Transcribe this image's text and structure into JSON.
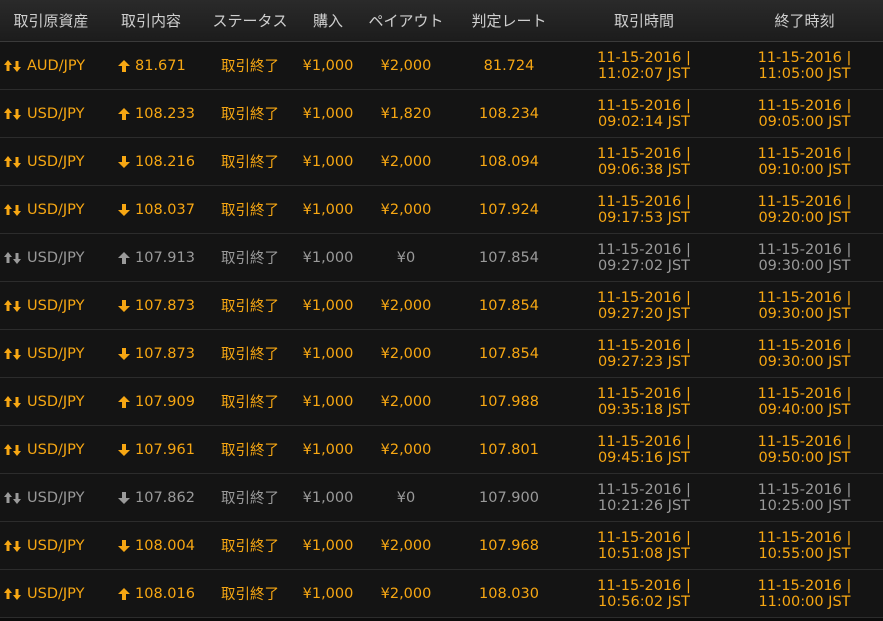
{
  "colors": {
    "win": "#f7a713",
    "lose": "#9a9a9a",
    "header_text": "#cfcfcf",
    "background": "#141414"
  },
  "header": {
    "asset": "取引原資産",
    "content": "取引内容",
    "status": "ステータス",
    "purchase": "購入",
    "payout": "ペイアウト",
    "judge_rate": "判定レート",
    "trade_time": "取引時間",
    "end_time": "終了時刻"
  },
  "rows": [
    {
      "result": "win",
      "asset_icon": "exchange-arrows-icon",
      "asset": "AUD/JPY",
      "direction": "up",
      "rate": "81.671",
      "status": "取引終了",
      "purchase": "¥1,000",
      "payout": "¥2,000",
      "judge_rate": "81.724",
      "trade_date": "11-15-2016 |",
      "trade_clock": "11:02:07 JST",
      "end_date": "11-15-2016 |",
      "end_clock": "11:05:00 JST"
    },
    {
      "result": "win",
      "asset_icon": "exchange-arrows-icon",
      "asset": "USD/JPY",
      "direction": "up",
      "rate": "108.233",
      "status": "取引終了",
      "purchase": "¥1,000",
      "payout": "¥1,820",
      "judge_rate": "108.234",
      "trade_date": "11-15-2016 |",
      "trade_clock": "09:02:14 JST",
      "end_date": "11-15-2016 |",
      "end_clock": "09:05:00 JST"
    },
    {
      "result": "win",
      "asset_icon": "exchange-arrows-icon",
      "asset": "USD/JPY",
      "direction": "down",
      "rate": "108.216",
      "status": "取引終了",
      "purchase": "¥1,000",
      "payout": "¥2,000",
      "judge_rate": "108.094",
      "trade_date": "11-15-2016 |",
      "trade_clock": "09:06:38 JST",
      "end_date": "11-15-2016 |",
      "end_clock": "09:10:00 JST"
    },
    {
      "result": "win",
      "asset_icon": "exchange-arrows-icon",
      "asset": "USD/JPY",
      "direction": "down",
      "rate": "108.037",
      "status": "取引終了",
      "purchase": "¥1,000",
      "payout": "¥2,000",
      "judge_rate": "107.924",
      "trade_date": "11-15-2016 |",
      "trade_clock": "09:17:53 JST",
      "end_date": "11-15-2016 |",
      "end_clock": "09:20:00 JST"
    },
    {
      "result": "lose",
      "asset_icon": "exchange-arrows-icon",
      "asset": "USD/JPY",
      "direction": "up",
      "rate": "107.913",
      "status": "取引終了",
      "purchase": "¥1,000",
      "payout": "¥0",
      "judge_rate": "107.854",
      "trade_date": "11-15-2016 |",
      "trade_clock": "09:27:02 JST",
      "end_date": "11-15-2016 |",
      "end_clock": "09:30:00 JST"
    },
    {
      "result": "win",
      "asset_icon": "exchange-arrows-icon",
      "asset": "USD/JPY",
      "direction": "down",
      "rate": "107.873",
      "status": "取引終了",
      "purchase": "¥1,000",
      "payout": "¥2,000",
      "judge_rate": "107.854",
      "trade_date": "11-15-2016 |",
      "trade_clock": "09:27:20 JST",
      "end_date": "11-15-2016 |",
      "end_clock": "09:30:00 JST"
    },
    {
      "result": "win",
      "asset_icon": "exchange-arrows-icon",
      "asset": "USD/JPY",
      "direction": "down",
      "rate": "107.873",
      "status": "取引終了",
      "purchase": "¥1,000",
      "payout": "¥2,000",
      "judge_rate": "107.854",
      "trade_date": "11-15-2016 |",
      "trade_clock": "09:27:23 JST",
      "end_date": "11-15-2016 |",
      "end_clock": "09:30:00 JST"
    },
    {
      "result": "win",
      "asset_icon": "exchange-arrows-icon",
      "asset": "USD/JPY",
      "direction": "up",
      "rate": "107.909",
      "status": "取引終了",
      "purchase": "¥1,000",
      "payout": "¥2,000",
      "judge_rate": "107.988",
      "trade_date": "11-15-2016 |",
      "trade_clock": "09:35:18 JST",
      "end_date": "11-15-2016 |",
      "end_clock": "09:40:00 JST"
    },
    {
      "result": "win",
      "asset_icon": "exchange-arrows-icon",
      "asset": "USD/JPY",
      "direction": "down",
      "rate": "107.961",
      "status": "取引終了",
      "purchase": "¥1,000",
      "payout": "¥2,000",
      "judge_rate": "107.801",
      "trade_date": "11-15-2016 |",
      "trade_clock": "09:45:16 JST",
      "end_date": "11-15-2016 |",
      "end_clock": "09:50:00 JST"
    },
    {
      "result": "lose",
      "asset_icon": "exchange-arrows-icon",
      "asset": "USD/JPY",
      "direction": "down",
      "rate": "107.862",
      "status": "取引終了",
      "purchase": "¥1,000",
      "payout": "¥0",
      "judge_rate": "107.900",
      "trade_date": "11-15-2016 |",
      "trade_clock": "10:21:26 JST",
      "end_date": "11-15-2016 |",
      "end_clock": "10:25:00 JST"
    },
    {
      "result": "win",
      "asset_icon": "exchange-arrows-icon",
      "asset": "USD/JPY",
      "direction": "down",
      "rate": "108.004",
      "status": "取引終了",
      "purchase": "¥1,000",
      "payout": "¥2,000",
      "judge_rate": "107.968",
      "trade_date": "11-15-2016 |",
      "trade_clock": "10:51:08 JST",
      "end_date": "11-15-2016 |",
      "end_clock": "10:55:00 JST"
    },
    {
      "result": "win",
      "asset_icon": "exchange-arrows-icon",
      "asset": "USD/JPY",
      "direction": "up",
      "rate": "108.016",
      "status": "取引終了",
      "purchase": "¥1,000",
      "payout": "¥2,000",
      "judge_rate": "108.030",
      "trade_date": "11-15-2016 |",
      "trade_clock": "10:56:02 JST",
      "end_date": "11-15-2016 |",
      "end_clock": "11:00:00 JST"
    }
  ]
}
